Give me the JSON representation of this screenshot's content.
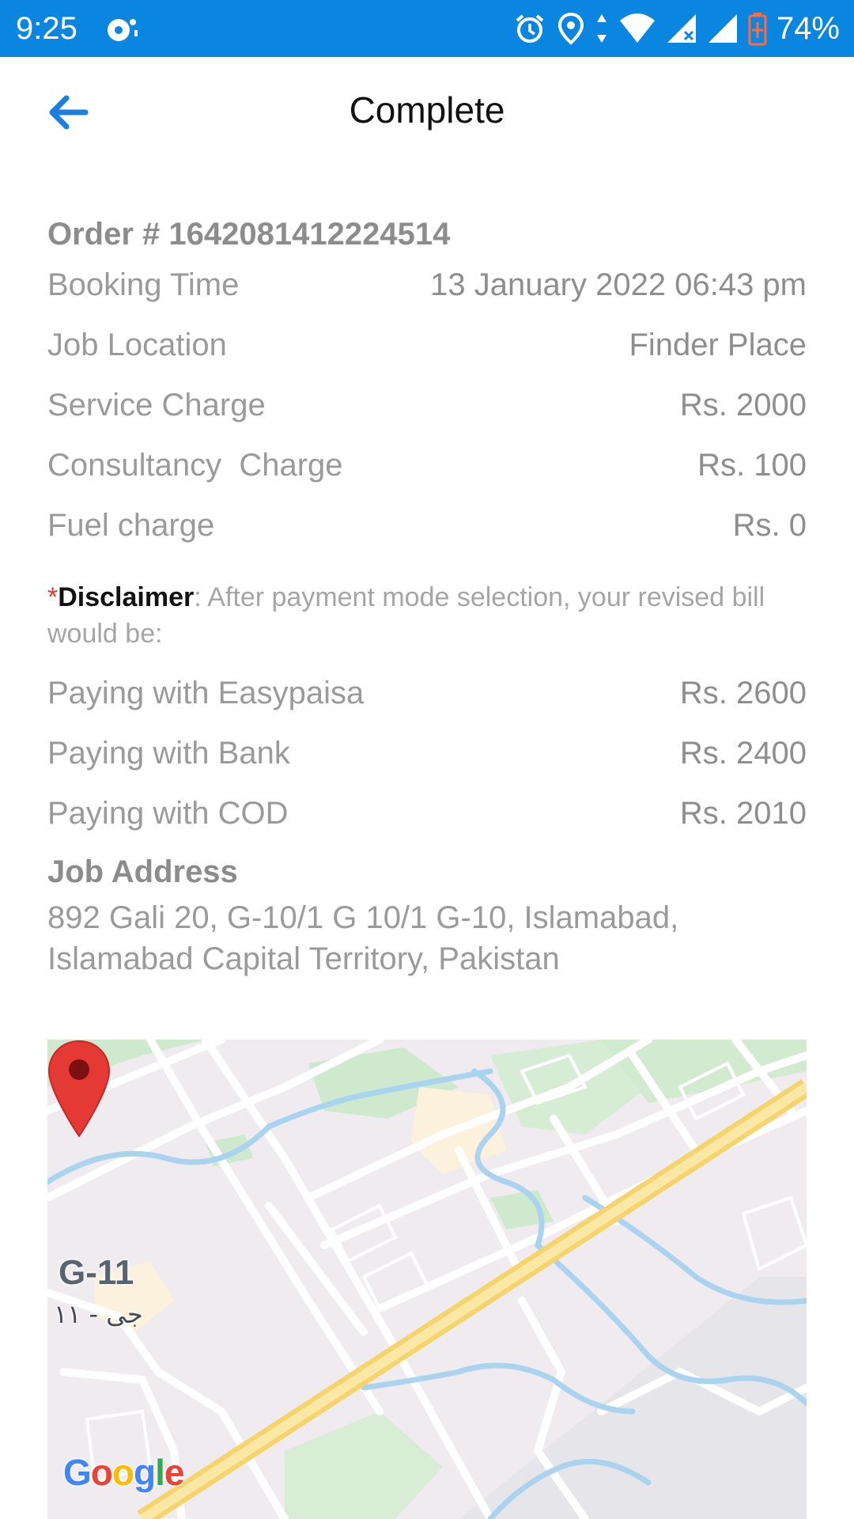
{
  "status_bar": {
    "time": "9:25",
    "battery": "74%",
    "left_icon": "notification-icon",
    "right_icons": [
      "alarm-icon",
      "location-icon",
      "data-arrows-icon",
      "wifi-icon",
      "signal-x-icon",
      "signal-icon",
      "battery-icon"
    ],
    "background_color": "#0b86e0"
  },
  "app_bar": {
    "title": "Complete",
    "back_icon": "arrow-left-icon",
    "accent_color": "#1a7fe0"
  },
  "order": {
    "number_label": "Order # 1642081412224514"
  },
  "details": [
    {
      "label": "Booking Time",
      "value": "13 January 2022 06:43 pm"
    },
    {
      "label": "Job Location",
      "value": "Finder Place"
    },
    {
      "label": "Service Charge",
      "value": "Rs. 2000"
    },
    {
      "label": "Consultancy  Charge",
      "value": "Rs. 100"
    },
    {
      "label": "Fuel charge",
      "value": "Rs. 0"
    }
  ],
  "disclaimer": {
    "star": "*",
    "title": "Disclaimer",
    "text": ": After payment mode selection, your revised bill would be:"
  },
  "payments": [
    {
      "label": "Paying with Easypaisa",
      "value": "Rs. 2600"
    },
    {
      "label": "Paying with Bank",
      "value": "Rs. 2400"
    },
    {
      "label": "Paying with COD",
      "value": "Rs. 2010"
    }
  ],
  "address": {
    "title": "Job Address",
    "line1": "892 Gali 20, G-10/1 G 10/1 G-10, Islamabad,",
    "line2": "Islamabad Capital Territory, Pakistan"
  },
  "map": {
    "area_label": "G-11",
    "area_label_urdu": "جی - ۱۱",
    "logo_letters": [
      "G",
      "o",
      "o",
      "g",
      "l",
      "e"
    ],
    "logo_colors": [
      "#4285f4",
      "#ea4335",
      "#fbbc05",
      "#4285f4",
      "#34a853",
      "#ea4335"
    ],
    "pin_color": "#e53935"
  }
}
